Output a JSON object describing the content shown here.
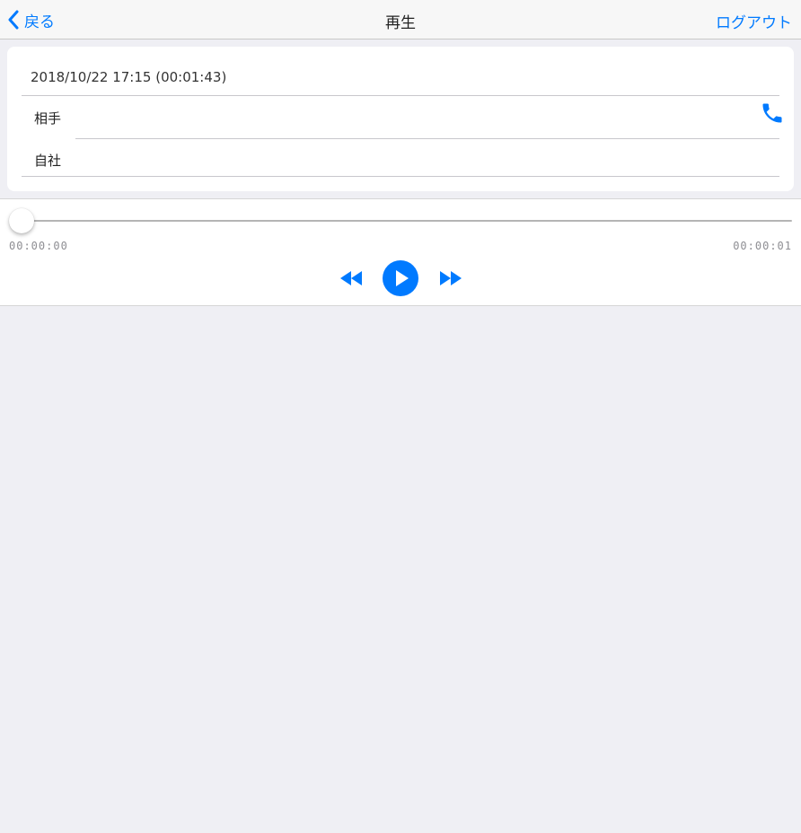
{
  "navbar": {
    "back_label": "戻る",
    "title": "再生",
    "logout_label": "ログアウト"
  },
  "call": {
    "datetime": "2018/10/22 17:15 (00:01:43)",
    "rows": [
      {
        "label": "相手"
      },
      {
        "label": "自社"
      }
    ]
  },
  "player": {
    "current_time": "00:00:00",
    "total_time": "00:00:01",
    "progress": 0
  },
  "icons": {
    "back": "chevron-left-icon",
    "phone": "phone-icon",
    "rewind": "rewind-icon",
    "play": "play-icon",
    "forward": "fast-forward-icon"
  },
  "colors": {
    "accent": "#007aff",
    "background": "#efeff4",
    "navbar": "#f7f7f7"
  }
}
